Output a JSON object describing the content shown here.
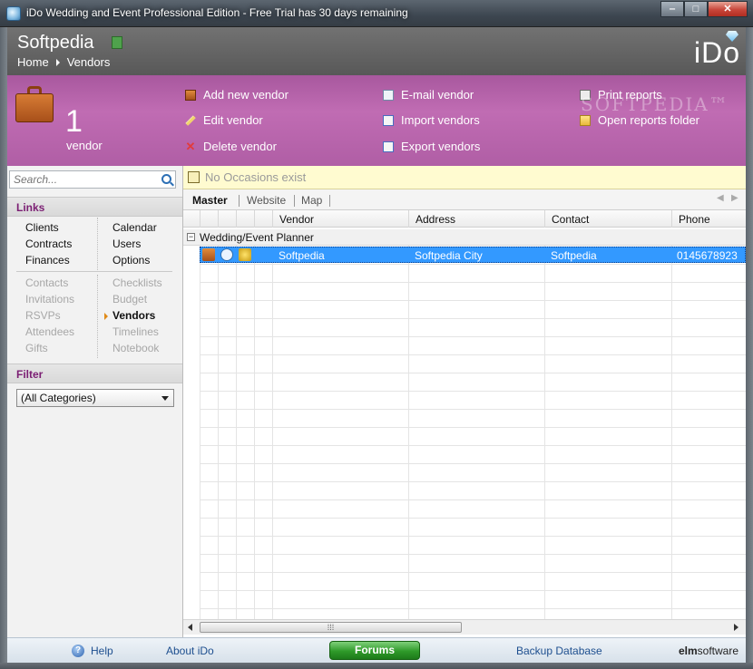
{
  "window": {
    "title": "iDo Wedding and Event Professional Edition - Free Trial has 30 days remaining",
    "min_glyph": "‒",
    "max_glyph": "□",
    "close_glyph": "✕"
  },
  "header": {
    "title": "Softpedia",
    "breadcrumb": [
      "Home",
      "Vendors"
    ],
    "brand": "iDo"
  },
  "band": {
    "count": "1",
    "count_label": "vendor",
    "watermark": "SOFTPEDIA™",
    "actions_col1": [
      "Add new vendor",
      "Edit vendor",
      "Delete vendor"
    ],
    "actions_col2": [
      "E-mail vendor",
      "Import vendors",
      "Export vendors"
    ],
    "actions_col3": [
      "Print reports",
      "Open reports folder"
    ]
  },
  "sidebar": {
    "search_placeholder": "Search...",
    "links_title": "Links",
    "links_left": [
      "Clients",
      "Contracts",
      "Finances"
    ],
    "links_right": [
      "Calendar",
      "Users",
      "Options"
    ],
    "links2_left": [
      "Contacts",
      "Invitations",
      "RSVPs",
      "Attendees",
      "Gifts"
    ],
    "links2_right": [
      "Checklists",
      "Budget",
      "Vendors",
      "Timelines",
      "Notebook"
    ],
    "filter_title": "Filter",
    "filter_value": "(All Categories)"
  },
  "main": {
    "notice": "No Occasions exist",
    "tabs": [
      "Master",
      "Website",
      "Map"
    ],
    "columns": [
      "Vendor",
      "Address",
      "Contact",
      "Phone"
    ],
    "group_label": "Wedding/Event Planner",
    "rows": [
      {
        "vendor": "Softpedia",
        "address": "Softpedia City",
        "contact": "Softpedia",
        "phone": "0145678923"
      }
    ],
    "scroll_grip": "⁞⁞⁞"
  },
  "footer": {
    "help": "Help",
    "about": "About iDo",
    "forums": "Forums",
    "backup": "Backup Database",
    "elm_bold": "elm",
    "elm_rest": "software"
  },
  "colors": {
    "accent_purple": "#b662aa",
    "section_title": "#7b1e73",
    "selection": "#3399ff"
  }
}
